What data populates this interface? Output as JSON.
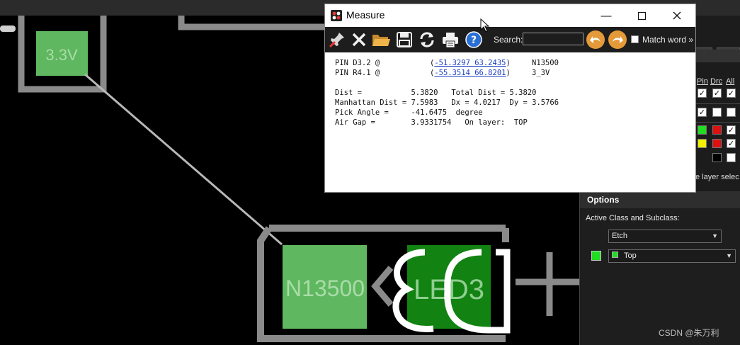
{
  "canvas": {
    "pad_3v3": "3.3V",
    "pad_n13500": "N13500",
    "part_led3": "LED3"
  },
  "measure": {
    "title": "Measure",
    "toolbar": {
      "search_label": "Search:",
      "search_value": "",
      "match_word_label": "Match word »"
    },
    "report": {
      "pin1_prefix": "PIN D3.2 @",
      "pin1_coords": "-51.3297 63.2435",
      "pin1_net": "N13500",
      "pin2_prefix": "PIN R4.1 @",
      "pin2_coords": "-55.3514 66.8201",
      "pin2_net": "3_3V",
      "line_dist": "Dist =           5.3820   Total Dist = 5.3820",
      "line_manhattan": "Manhattan Dist = 7.5983   Dx = 4.0217  Dy = 3.5766",
      "line_pick": "Pick Angle =     -41.6475  degree",
      "line_airgap": "Air Gap =        3.9331754   On layer:  TOP"
    }
  },
  "visibility": {
    "headers": [
      "Pin",
      "Drc",
      "All"
    ],
    "note": "e layer selec"
  },
  "options": {
    "title": "Options",
    "active_class_label": "Active Class and Subclass:",
    "class_value": "Etch",
    "subclass_value": "Top"
  },
  "watermark": "CSDN @朱万利",
  "colors": {
    "pad_green": "#5fb760",
    "led_green": "#128212",
    "outline_gray": "#8a8a8a",
    "top_layer_green": "#22dd22"
  }
}
